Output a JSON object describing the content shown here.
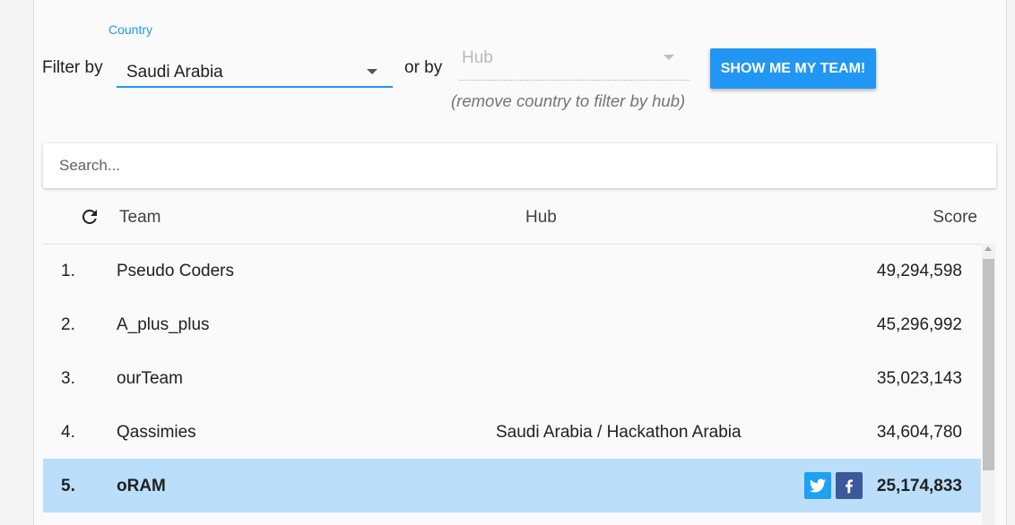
{
  "filters": {
    "filter_by_label": "Filter by",
    "country_label": "Country",
    "country_value": "Saudi Arabia",
    "or_by_label": "or by",
    "hub_placeholder": "Hub",
    "hub_hint": "(remove country to filter by hub)",
    "show_team_button": "SHOW ME MY TEAM!"
  },
  "search": {
    "placeholder": "Search..."
  },
  "table": {
    "columns": {
      "team": "Team",
      "hub": "Hub",
      "score": "Score"
    },
    "rows": [
      {
        "rank": "1.",
        "team": "Pseudo Coders",
        "hub": "",
        "score": "49,294,598"
      },
      {
        "rank": "2.",
        "team": "A_plus_plus",
        "hub": "",
        "score": "45,296,992"
      },
      {
        "rank": "3.",
        "team": "ourTeam",
        "hub": "",
        "score": "35,023,143"
      },
      {
        "rank": "4.",
        "team": "Qassimies",
        "hub": "Saudi Arabia / Hackathon Arabia",
        "score": "34,604,780"
      },
      {
        "rank": "5.",
        "team": "oRAM",
        "hub": "",
        "score": "25,174,833",
        "highlighted": true
      }
    ]
  },
  "colors": {
    "accent": "#2196f3",
    "highlight_row": "#bbdefb",
    "twitter": "#1da1f2",
    "facebook": "#3b5998"
  },
  "icons": {
    "refresh": "refresh-icon",
    "dropdown": "chevron-down-icon",
    "twitter": "twitter-icon",
    "facebook": "facebook-icon"
  }
}
